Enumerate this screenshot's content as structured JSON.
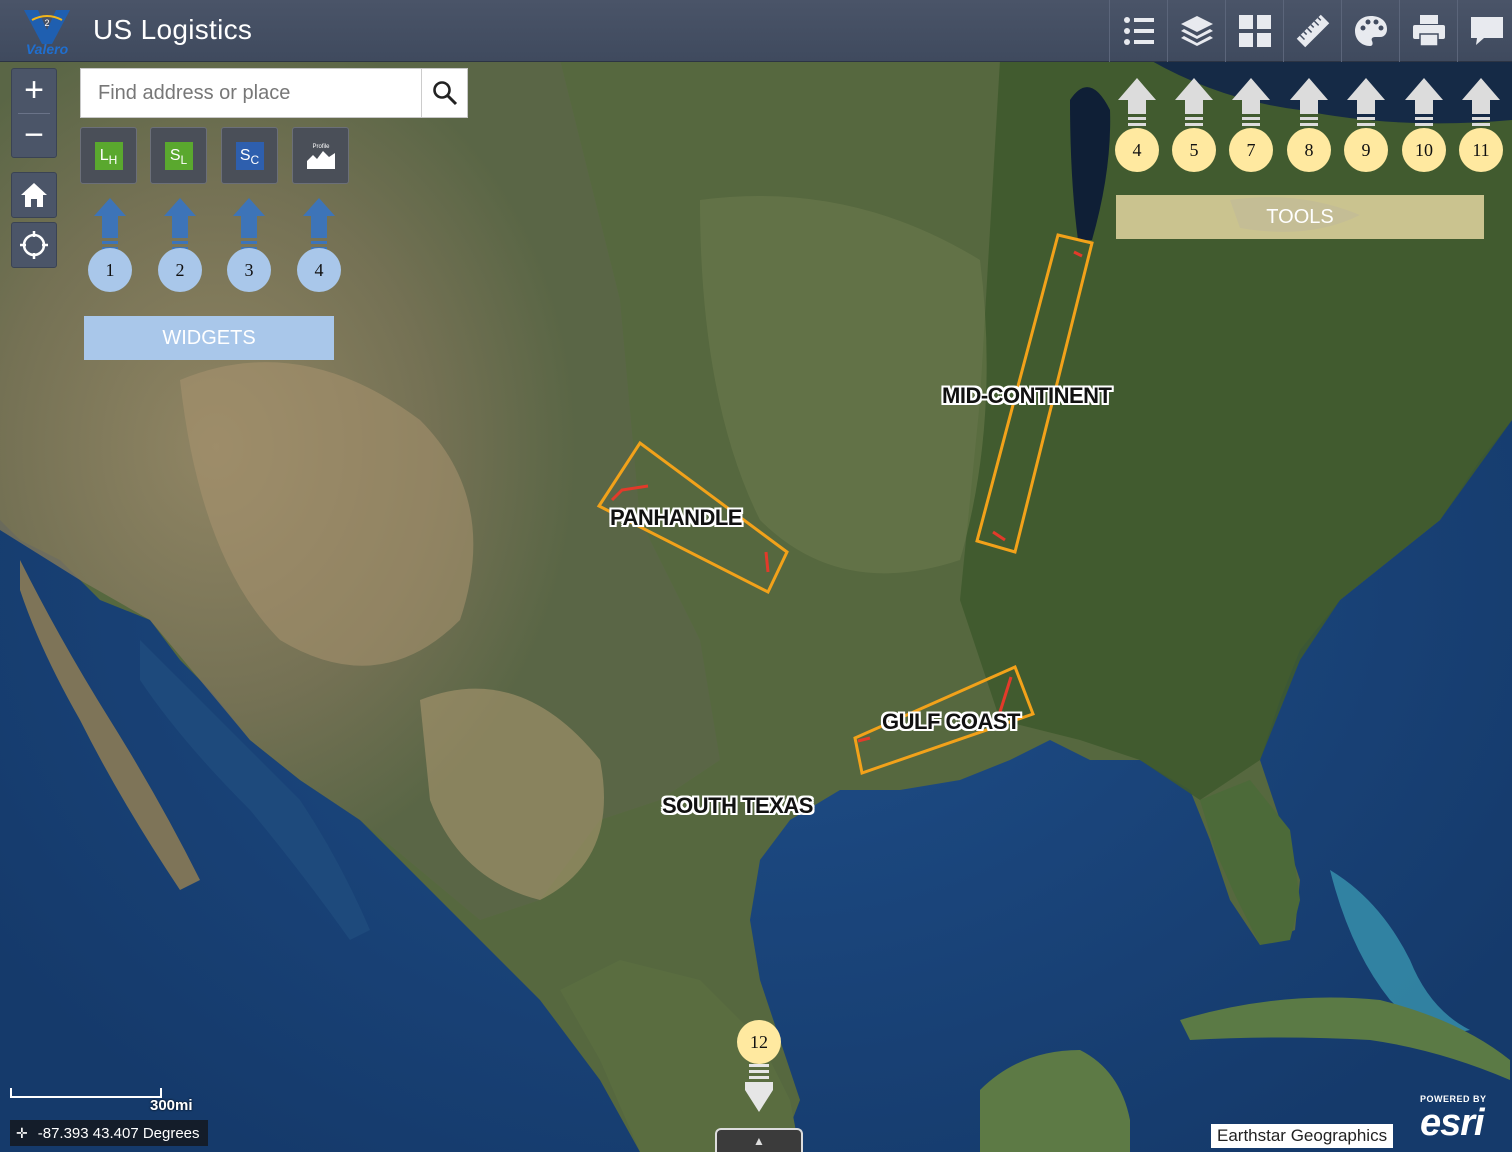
{
  "header": {
    "brand": "Valero",
    "title": "US Logistics",
    "tools": [
      {
        "name": "legend-icon"
      },
      {
        "name": "layers-icon"
      },
      {
        "name": "basemap-gallery-icon"
      },
      {
        "name": "measure-ruler-icon"
      },
      {
        "name": "draw-palette-icon"
      },
      {
        "name": "print-icon"
      },
      {
        "name": "feedback-chat-icon"
      }
    ]
  },
  "search": {
    "placeholder": "Find address or place"
  },
  "zoom": {
    "in": "+",
    "out": "−"
  },
  "widgets": [
    {
      "label_top": "L",
      "label_bottom": "H",
      "color": "#5aa82e"
    },
    {
      "label_top": "S",
      "label_bottom": "L",
      "color": "#5aa82e"
    },
    {
      "label_top": "S",
      "label_bottom": "C",
      "color": "#2e5fae"
    },
    {
      "label": "Profile",
      "color": "#4a4f58"
    }
  ],
  "widget_callouts": [
    "1",
    "2",
    "3",
    "4"
  ],
  "widgets_banner": "WIDGETS",
  "tool_callouts": [
    "4",
    "5",
    "7",
    "8",
    "9",
    "10",
    "11"
  ],
  "tools_banner": "TOOLS",
  "regions": {
    "panhandle": "PANHANDLE",
    "mid_continent": "MID-CONTINENT",
    "gulf_coast": "GULF COAST",
    "south_texas": "SOUTH TEXAS"
  },
  "bottom_callout": "12",
  "scale": "300mi",
  "coordinates": "-87.393 43.407 Degrees",
  "attribution": "Earthstar Geographics",
  "esri": {
    "powered": "POWERED BY",
    "word": "esri"
  },
  "colors": {
    "region_outline": "#f2a21a",
    "pipeline": "#e33a2a",
    "callout_blue": "#a9c7ea",
    "callout_yellow": "#ffe9a0",
    "header": "#424c60"
  }
}
